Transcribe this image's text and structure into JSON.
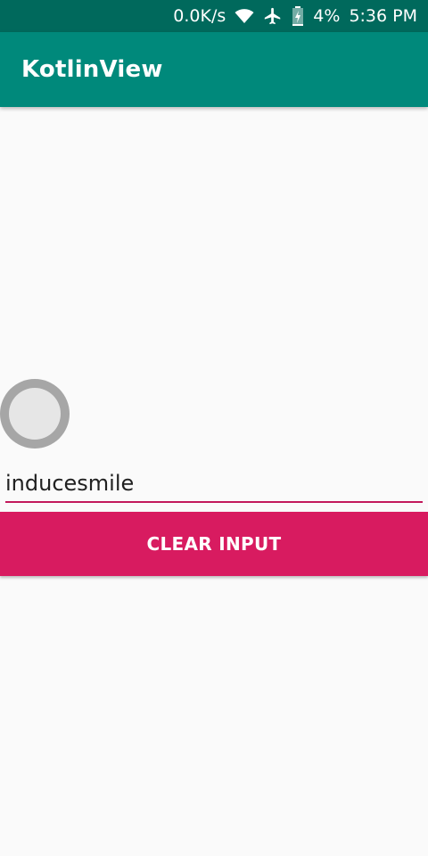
{
  "status_bar": {
    "speed": "0.0K/s",
    "battery": "4%",
    "time": "5:36 PM",
    "icons": [
      "wifi-icon",
      "airplane-icon",
      "battery-charging-icon"
    ]
  },
  "app_bar": {
    "title": "KotlinView"
  },
  "main": {
    "radio_checked": false,
    "input_value": "inducesmile",
    "clear_button_label": "CLEAR INPUT"
  },
  "colors": {
    "status_bar": "#00695c",
    "app_bar": "#00897b",
    "accent": "#d81b60",
    "background": "#fafafa"
  }
}
